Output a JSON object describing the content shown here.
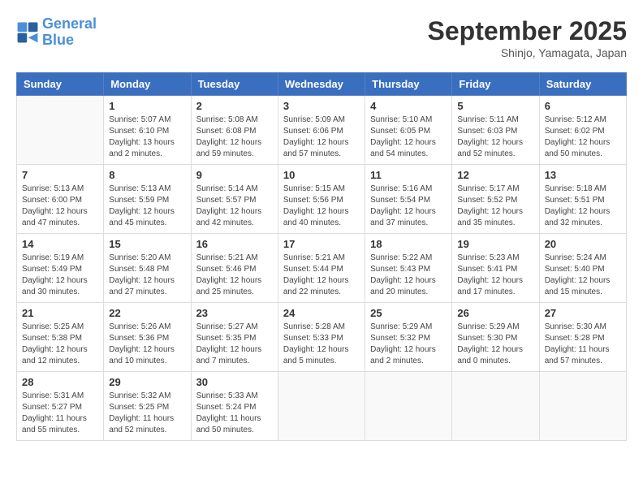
{
  "header": {
    "logo_line1": "General",
    "logo_line2": "Blue",
    "main_title": "September 2025",
    "subtitle": "Shinjo, Yamagata, Japan"
  },
  "weekdays": [
    "Sunday",
    "Monday",
    "Tuesday",
    "Wednesday",
    "Thursday",
    "Friday",
    "Saturday"
  ],
  "weeks": [
    [
      {
        "day": "",
        "info": ""
      },
      {
        "day": "1",
        "info": "Sunrise: 5:07 AM\nSunset: 6:10 PM\nDaylight: 13 hours\nand 2 minutes."
      },
      {
        "day": "2",
        "info": "Sunrise: 5:08 AM\nSunset: 6:08 PM\nDaylight: 12 hours\nand 59 minutes."
      },
      {
        "day": "3",
        "info": "Sunrise: 5:09 AM\nSunset: 6:06 PM\nDaylight: 12 hours\nand 57 minutes."
      },
      {
        "day": "4",
        "info": "Sunrise: 5:10 AM\nSunset: 6:05 PM\nDaylight: 12 hours\nand 54 minutes."
      },
      {
        "day": "5",
        "info": "Sunrise: 5:11 AM\nSunset: 6:03 PM\nDaylight: 12 hours\nand 52 minutes."
      },
      {
        "day": "6",
        "info": "Sunrise: 5:12 AM\nSunset: 6:02 PM\nDaylight: 12 hours\nand 50 minutes."
      }
    ],
    [
      {
        "day": "7",
        "info": "Sunrise: 5:13 AM\nSunset: 6:00 PM\nDaylight: 12 hours\nand 47 minutes."
      },
      {
        "day": "8",
        "info": "Sunrise: 5:13 AM\nSunset: 5:59 PM\nDaylight: 12 hours\nand 45 minutes."
      },
      {
        "day": "9",
        "info": "Sunrise: 5:14 AM\nSunset: 5:57 PM\nDaylight: 12 hours\nand 42 minutes."
      },
      {
        "day": "10",
        "info": "Sunrise: 5:15 AM\nSunset: 5:56 PM\nDaylight: 12 hours\nand 40 minutes."
      },
      {
        "day": "11",
        "info": "Sunrise: 5:16 AM\nSunset: 5:54 PM\nDaylight: 12 hours\nand 37 minutes."
      },
      {
        "day": "12",
        "info": "Sunrise: 5:17 AM\nSunset: 5:52 PM\nDaylight: 12 hours\nand 35 minutes."
      },
      {
        "day": "13",
        "info": "Sunrise: 5:18 AM\nSunset: 5:51 PM\nDaylight: 12 hours\nand 32 minutes."
      }
    ],
    [
      {
        "day": "14",
        "info": "Sunrise: 5:19 AM\nSunset: 5:49 PM\nDaylight: 12 hours\nand 30 minutes."
      },
      {
        "day": "15",
        "info": "Sunrise: 5:20 AM\nSunset: 5:48 PM\nDaylight: 12 hours\nand 27 minutes."
      },
      {
        "day": "16",
        "info": "Sunrise: 5:21 AM\nSunset: 5:46 PM\nDaylight: 12 hours\nand 25 minutes."
      },
      {
        "day": "17",
        "info": "Sunrise: 5:21 AM\nSunset: 5:44 PM\nDaylight: 12 hours\nand 22 minutes."
      },
      {
        "day": "18",
        "info": "Sunrise: 5:22 AM\nSunset: 5:43 PM\nDaylight: 12 hours\nand 20 minutes."
      },
      {
        "day": "19",
        "info": "Sunrise: 5:23 AM\nSunset: 5:41 PM\nDaylight: 12 hours\nand 17 minutes."
      },
      {
        "day": "20",
        "info": "Sunrise: 5:24 AM\nSunset: 5:40 PM\nDaylight: 12 hours\nand 15 minutes."
      }
    ],
    [
      {
        "day": "21",
        "info": "Sunrise: 5:25 AM\nSunset: 5:38 PM\nDaylight: 12 hours\nand 12 minutes."
      },
      {
        "day": "22",
        "info": "Sunrise: 5:26 AM\nSunset: 5:36 PM\nDaylight: 12 hours\nand 10 minutes."
      },
      {
        "day": "23",
        "info": "Sunrise: 5:27 AM\nSunset: 5:35 PM\nDaylight: 12 hours\nand 7 minutes."
      },
      {
        "day": "24",
        "info": "Sunrise: 5:28 AM\nSunset: 5:33 PM\nDaylight: 12 hours\nand 5 minutes."
      },
      {
        "day": "25",
        "info": "Sunrise: 5:29 AM\nSunset: 5:32 PM\nDaylight: 12 hours\nand 2 minutes."
      },
      {
        "day": "26",
        "info": "Sunrise: 5:29 AM\nSunset: 5:30 PM\nDaylight: 12 hours\nand 0 minutes."
      },
      {
        "day": "27",
        "info": "Sunrise: 5:30 AM\nSunset: 5:28 PM\nDaylight: 11 hours\nand 57 minutes."
      }
    ],
    [
      {
        "day": "28",
        "info": "Sunrise: 5:31 AM\nSunset: 5:27 PM\nDaylight: 11 hours\nand 55 minutes."
      },
      {
        "day": "29",
        "info": "Sunrise: 5:32 AM\nSunset: 5:25 PM\nDaylight: 11 hours\nand 52 minutes."
      },
      {
        "day": "30",
        "info": "Sunrise: 5:33 AM\nSunset: 5:24 PM\nDaylight: 11 hours\nand 50 minutes."
      },
      {
        "day": "",
        "info": ""
      },
      {
        "day": "",
        "info": ""
      },
      {
        "day": "",
        "info": ""
      },
      {
        "day": "",
        "info": ""
      }
    ]
  ]
}
